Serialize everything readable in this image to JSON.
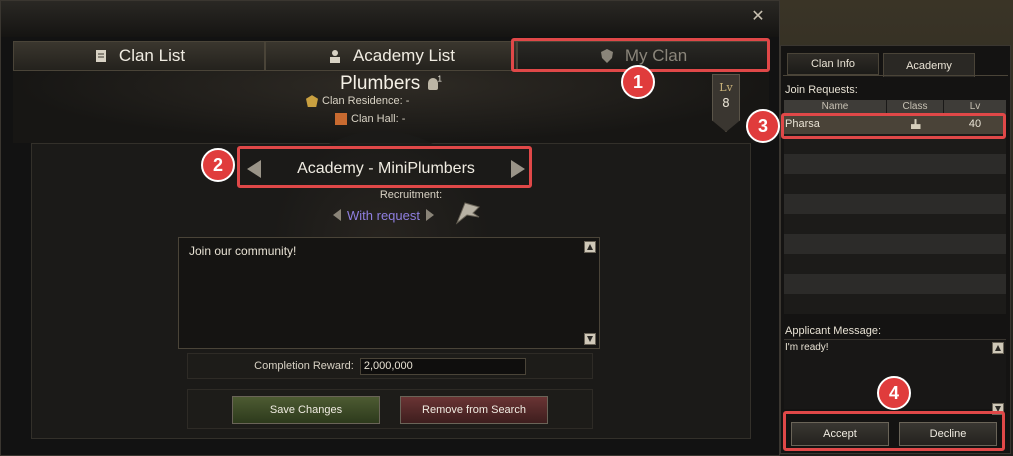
{
  "window": {
    "close_glyph": "✕"
  },
  "tabs": [
    {
      "label": "Clan List",
      "icon": "scroll-icon"
    },
    {
      "label": "Academy List",
      "icon": "academy-icon"
    },
    {
      "label": "My Clan",
      "icon": "shield-icon"
    }
  ],
  "clan": {
    "name": "Plumbers",
    "member_suffix": "1",
    "residence_label": "Clan Residence: -",
    "hall_label": "Clan Hall: -",
    "level_label": "Lv",
    "level": "8"
  },
  "academy": {
    "name": "Academy - MiniPlumbers",
    "recruitment_label": "Recruitment:",
    "recruitment_value": "With request",
    "message": "Join our community!",
    "completion_reward_label": "Completion Reward:",
    "completion_reward": "2,000,000",
    "save_label": "Save Changes",
    "remove_label": "Remove from Search"
  },
  "right_panel": {
    "tabs": [
      "Clan Info",
      "Academy"
    ],
    "join_requests_label": "Join Requests:",
    "columns": [
      "Name",
      "Class",
      "Lv"
    ],
    "requests": [
      {
        "name": "Pharsa",
        "class_icon": "sword-icon",
        "lv": "40"
      }
    ],
    "applicant_message_label": "Applicant Message:",
    "applicant_message": "I'm ready!",
    "accept_label": "Accept",
    "decline_label": "Decline"
  },
  "annotations": [
    "1",
    "2",
    "3",
    "4"
  ],
  "colors": {
    "highlight": "#e04848",
    "recruit_link": "#8f7fe0"
  }
}
